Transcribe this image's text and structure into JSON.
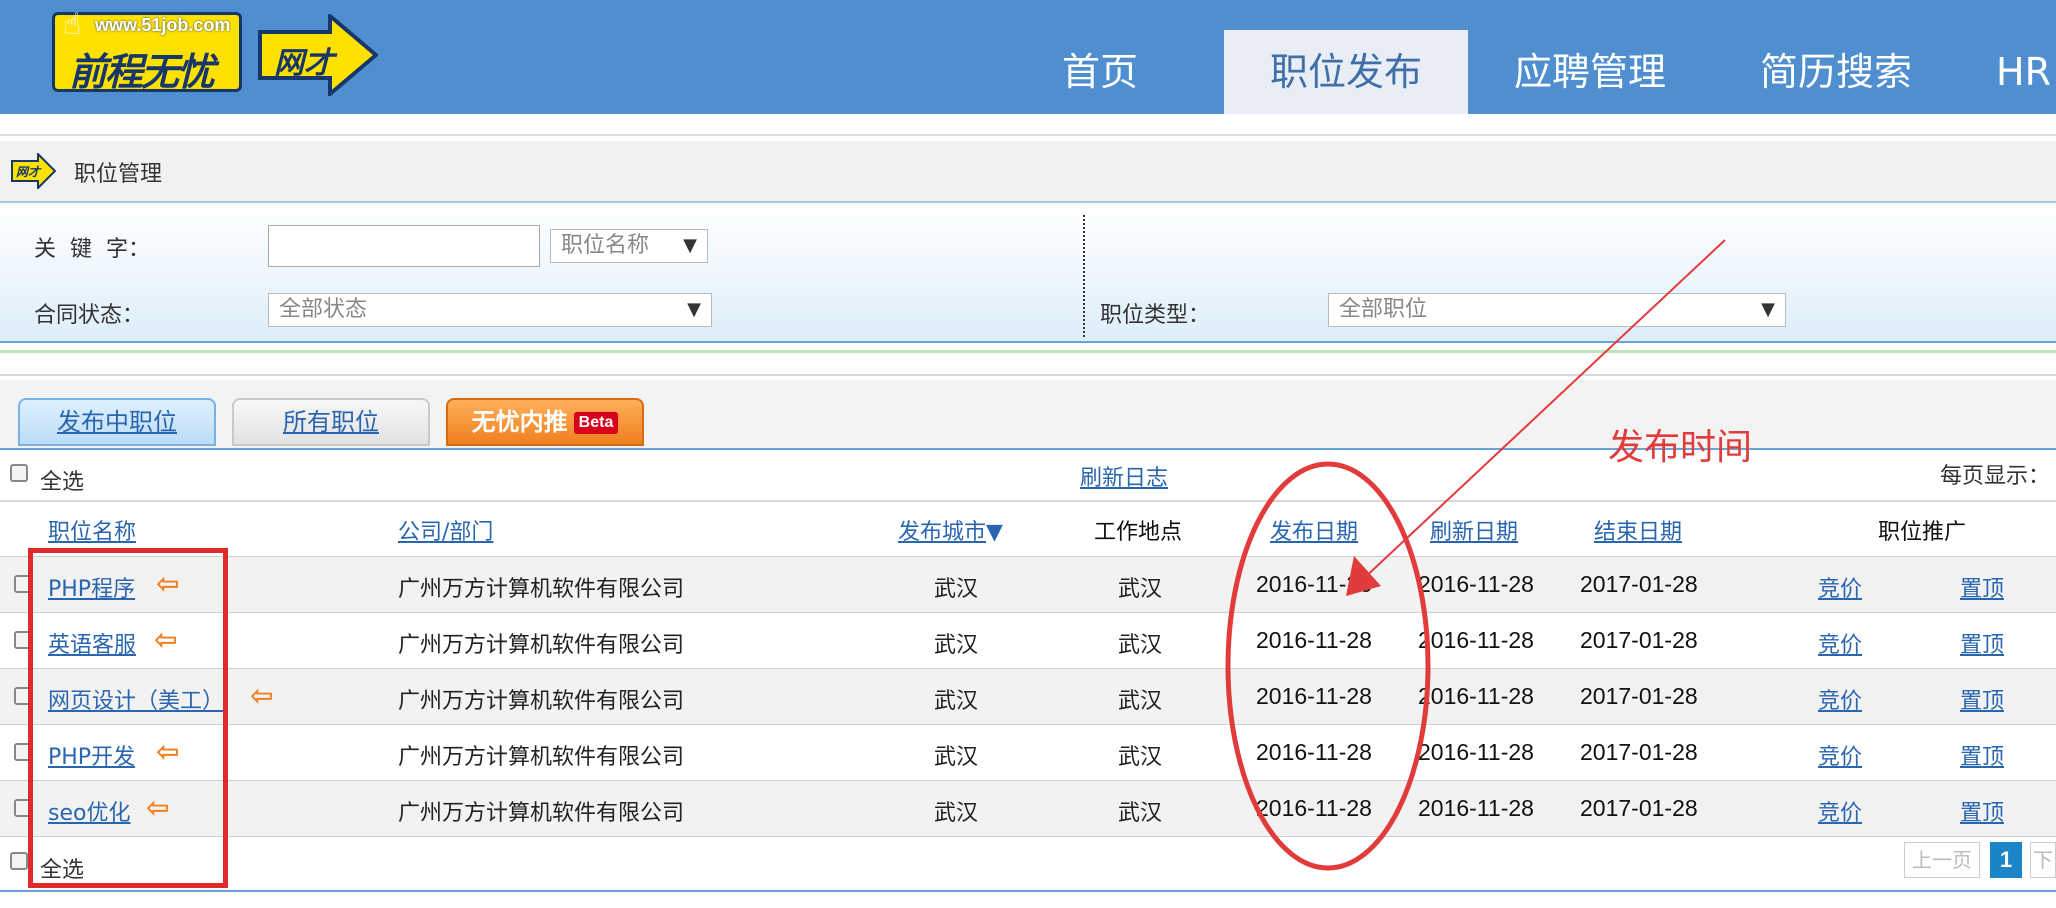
{
  "header": {
    "logo_url": "www.51job.com",
    "logo_brand": "前程无忧",
    "logo_sub": "网才",
    "nav": [
      {
        "label": "首页",
        "active": false
      },
      {
        "label": "职位发布",
        "active": true
      },
      {
        "label": "应聘管理",
        "active": false
      },
      {
        "label": "简历搜索",
        "active": false
      },
      {
        "label": "HR",
        "active": false
      }
    ]
  },
  "breadcrumb": {
    "title": "职位管理",
    "icon": "wangcai-logo-icon"
  },
  "filters": {
    "keyword_label": "关  键  字：",
    "keyword_value": "",
    "keyword_field_select": "职位名称",
    "contract_label": "合同状态：",
    "contract_select": "全部状态",
    "jobtype_label": "职位类型：",
    "jobtype_select": "全部职位"
  },
  "tabs": [
    {
      "label": "发布中职位",
      "active": true
    },
    {
      "label": "所有职位",
      "active": false
    },
    {
      "label": "无忧内推",
      "badge": "Beta",
      "active": false
    }
  ],
  "toolbar": {
    "select_all": "全选",
    "refresh_log": "刷新日志",
    "per_page": "每页显示："
  },
  "table": {
    "columns": [
      "职位名称",
      "公司/部门",
      "发布城市",
      "工作地点",
      "发布日期",
      "刷新日期",
      "结束日期",
      "职位推广"
    ],
    "rows": [
      {
        "title": "PHP程序",
        "company": "广州万方计算机软件有限公司",
        "city": "武汉",
        "location": "武汉",
        "publish": "2016-11-28",
        "refresh": "2016-11-28",
        "end": "2017-01-28",
        "bid": "竞价",
        "top": "置顶"
      },
      {
        "title": "英语客服",
        "company": "广州万方计算机软件有限公司",
        "city": "武汉",
        "location": "武汉",
        "publish": "2016-11-28",
        "refresh": "2016-11-28",
        "end": "2017-01-28",
        "bid": "竞价",
        "top": "置顶"
      },
      {
        "title": "网页设计（美工）",
        "company": "广州万方计算机软件有限公司",
        "city": "武汉",
        "location": "武汉",
        "publish": "2016-11-28",
        "refresh": "2016-11-28",
        "end": "2017-01-28",
        "bid": "竞价",
        "top": "置顶"
      },
      {
        "title": "PHP开发",
        "company": "广州万方计算机软件有限公司",
        "city": "武汉",
        "location": "武汉",
        "publish": "2016-11-28",
        "refresh": "2016-11-28",
        "end": "2017-01-28",
        "bid": "竞价",
        "top": "置顶"
      },
      {
        "title": "seo优化",
        "company": "广州万方计算机软件有限公司",
        "city": "武汉",
        "location": "武汉",
        "publish": "2016-11-28",
        "refresh": "2016-11-28",
        "end": "2017-01-28",
        "bid": "竞价",
        "top": "置顶"
      }
    ]
  },
  "footer": {
    "select_all": "全选",
    "prev": "上一页",
    "current_page": "1",
    "next": "下"
  },
  "annotation": {
    "label": "发布时间",
    "color": "#e23b3b"
  }
}
